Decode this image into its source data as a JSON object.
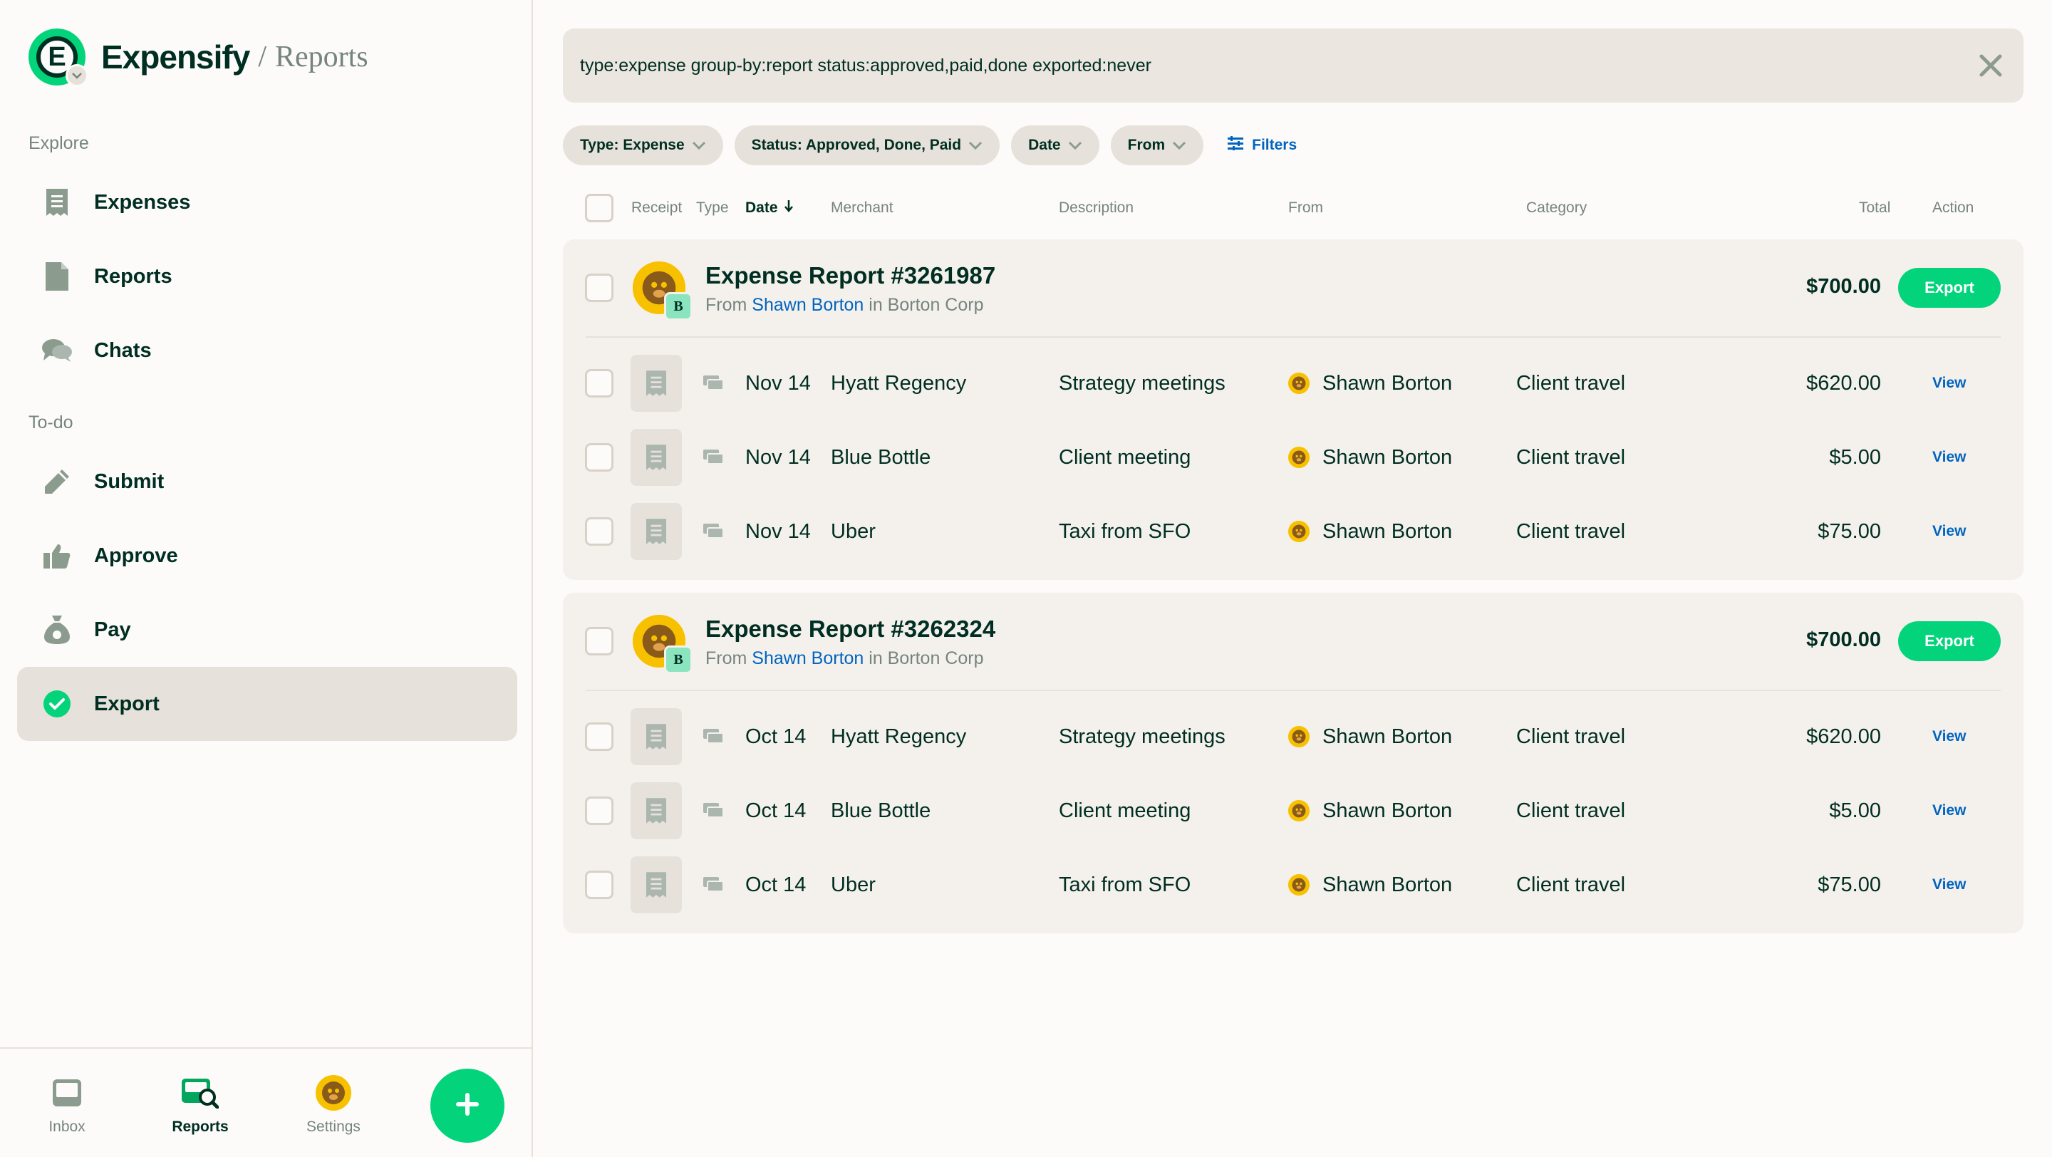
{
  "app": {
    "brand": "Expensify",
    "separator": "/",
    "page": "Reports",
    "logo_letter": "E"
  },
  "sidebar": {
    "explore_label": "Explore",
    "todo_label": "To-do",
    "explore_items": [
      {
        "label": "Expenses",
        "icon": "receipt-icon"
      },
      {
        "label": "Reports",
        "icon": "document-icon"
      },
      {
        "label": "Chats",
        "icon": "chat-bubbles-icon"
      }
    ],
    "todo_items": [
      {
        "label": "Submit",
        "icon": "pencil-icon"
      },
      {
        "label": "Approve",
        "icon": "thumbs-up-icon"
      },
      {
        "label": "Pay",
        "icon": "money-bag-icon"
      },
      {
        "label": "Export",
        "icon": "check-circle-icon",
        "active": true
      }
    ]
  },
  "bottom_tabs": [
    {
      "label": "Inbox",
      "icon": "inbox-icon"
    },
    {
      "label": "Reports",
      "icon": "reports-search-icon",
      "active": true
    },
    {
      "label": "Settings",
      "icon": "avatar-icon"
    }
  ],
  "fab": {
    "icon": "plus-icon"
  },
  "search": {
    "query": "type:expense group-by:report status:approved,paid,done exported:never"
  },
  "filters": {
    "chips": [
      "Type: Expense",
      "Status: Approved, Done, Paid",
      "Date",
      "From"
    ],
    "filters_link": "Filters"
  },
  "columns": {
    "receipt": "Receipt",
    "type": "Type",
    "date": "Date",
    "merchant": "Merchant",
    "description": "Description",
    "from": "From",
    "category": "Category",
    "total": "Total",
    "action": "Action"
  },
  "reports": [
    {
      "title": "Expense Report #3261987",
      "from_prefix": "From",
      "from_name": "Shawn Borton",
      "in_text": "in Borton Corp",
      "badge": "B",
      "total": "$700.00",
      "action": "Export",
      "rows": [
        {
          "date": "Nov 14",
          "merchant": "Hyatt Regency",
          "description": "Strategy meetings",
          "from": "Shawn Borton",
          "category": "Client travel",
          "total": "$620.00",
          "action": "View"
        },
        {
          "date": "Nov 14",
          "merchant": "Blue Bottle",
          "description": "Client meeting",
          "from": "Shawn Borton",
          "category": "Client travel",
          "total": "$5.00",
          "action": "View"
        },
        {
          "date": "Nov 14",
          "merchant": "Uber",
          "description": "Taxi from SFO",
          "from": "Shawn Borton",
          "category": "Client travel",
          "total": "$75.00",
          "action": "View"
        }
      ]
    },
    {
      "title": "Expense Report #3262324",
      "from_prefix": "From",
      "from_name": "Shawn Borton",
      "in_text": "in Borton Corp",
      "badge": "B",
      "total": "$700.00",
      "action": "Export",
      "rows": [
        {
          "date": "Oct 14",
          "merchant": "Hyatt Regency",
          "description": "Strategy meetings",
          "from": "Shawn Borton",
          "category": "Client travel",
          "total": "$620.00",
          "action": "View"
        },
        {
          "date": "Oct 14",
          "merchant": "Blue Bottle",
          "description": "Client meeting",
          "from": "Shawn Borton",
          "category": "Client travel",
          "total": "$5.00",
          "action": "View"
        },
        {
          "date": "Oct 14",
          "merchant": "Uber",
          "description": "Taxi from SFO",
          "from": "Shawn Borton",
          "category": "Client travel",
          "total": "$75.00",
          "action": "View"
        }
      ]
    }
  ],
  "colors": {
    "accent_green": "#03d47c",
    "link_blue": "#0164bf",
    "text_dark": "#002e22",
    "text_muted": "#76847e",
    "avatar_yellow": "#f8c100"
  }
}
